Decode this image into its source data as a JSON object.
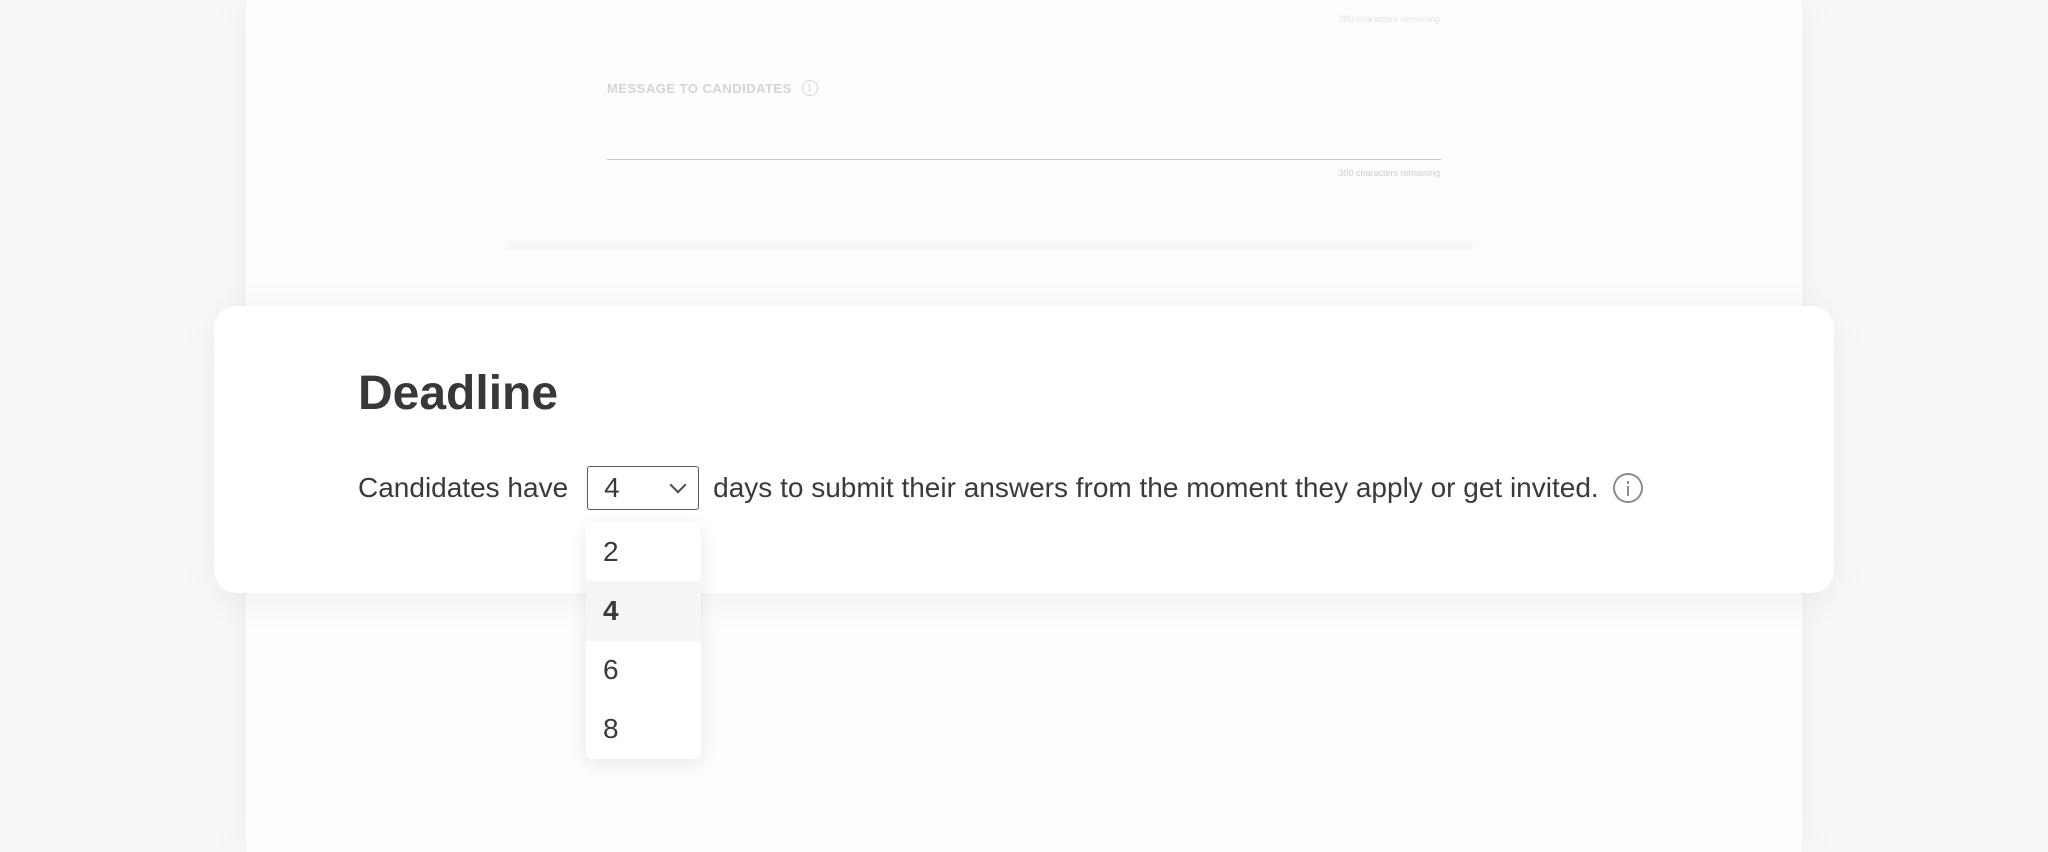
{
  "background_form": {
    "top_hint": "300 characters remaining",
    "message_label": "MESSAGE TO CANDIDATES",
    "message_remaining": "300 characters remaining"
  },
  "deadline": {
    "title": "Deadline",
    "prefix_text": "Candidates have",
    "selected_days": "4",
    "suffix_text": "days to submit their answers from the moment they apply or get invited.",
    "options": [
      "2",
      "4",
      "6",
      "8"
    ]
  },
  "icons": {
    "info": "info-icon",
    "chevron": "chevron-down-icon"
  },
  "colors": {
    "text": "#39393d",
    "card": "#ffffff",
    "background": "#f8f8f8",
    "selected_option_bg": "#f5f5f5"
  }
}
